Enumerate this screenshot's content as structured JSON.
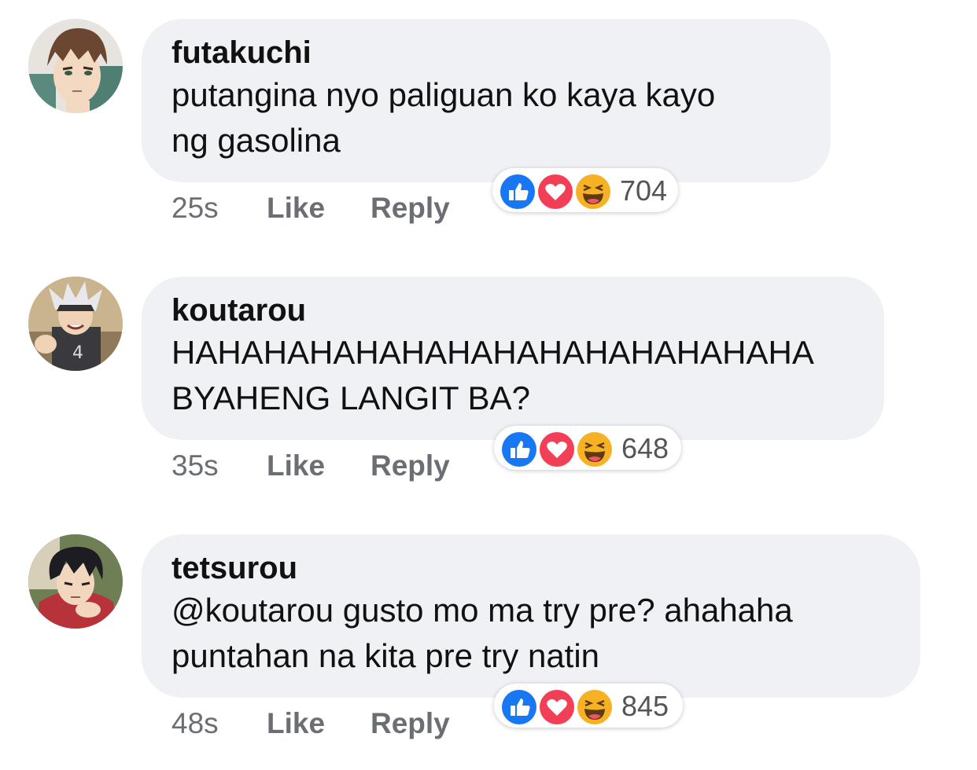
{
  "comments": [
    {
      "author": "futakuchi",
      "text": "putangina nyo paliguan ko kaya kayo\nng gasolina",
      "time": "25s",
      "like_label": "Like",
      "reply_label": "Reply",
      "reaction_count": "704",
      "reactions": [
        "like-icon",
        "love-icon",
        "haha-icon"
      ]
    },
    {
      "author": "koutarou",
      "text": "HAHAHAHAHAHAHAHAHAHAHAHAHAHA\nBYAHENG LANGIT BA?",
      "time": "35s",
      "like_label": "Like",
      "reply_label": "Reply",
      "reaction_count": "648",
      "reactions": [
        "like-icon",
        "love-icon",
        "haha-icon"
      ]
    },
    {
      "author": "tetsurou",
      "text": "@koutarou gusto mo ma try pre? ahahaha\npuntahan na kita pre try natin",
      "time": "48s",
      "like_label": "Like",
      "reply_label": "Reply",
      "reaction_count": "845",
      "reactions": [
        "like-icon",
        "love-icon",
        "haha-icon"
      ]
    }
  ],
  "colors": {
    "bubble": "#f0f1f4",
    "like_blue": "#1877f2",
    "love_red": "#f33e58",
    "haha_yellow": "#f7b125",
    "meta_gray": "#6b6e73"
  }
}
